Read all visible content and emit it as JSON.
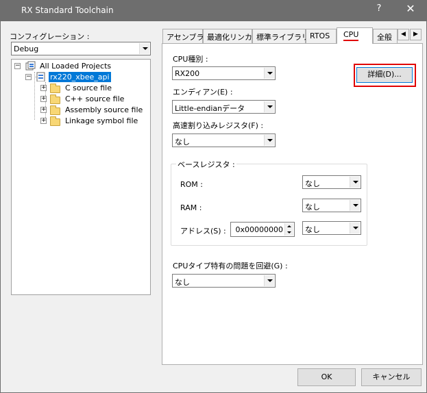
{
  "window": {
    "title": "RX Standard Toolchain",
    "help_label": "?",
    "close_label": "✕"
  },
  "config": {
    "label": "コンフィグレーション :",
    "value": "Debug"
  },
  "tree": {
    "root": {
      "label": "All Loaded Projects",
      "expander": "−"
    },
    "project": {
      "label": "rx220_xbee_api",
      "expander": "−"
    },
    "items": [
      {
        "label": "C source file",
        "expander": "+"
      },
      {
        "label": "C++ source file",
        "expander": "+"
      },
      {
        "label": "Assembly source file",
        "expander": "+"
      },
      {
        "label": "Linkage symbol file",
        "expander": "+"
      }
    ]
  },
  "tabs": [
    {
      "label": "アセンブラ"
    },
    {
      "label": "最適化リンカ"
    },
    {
      "label": "標準ライブラリ"
    },
    {
      "label": "RTOS"
    },
    {
      "label": "CPU"
    },
    {
      "label": "全般"
    }
  ],
  "tab_scroll": {
    "left": "◀",
    "right": "▶"
  },
  "cpu": {
    "cpu_type_label": "CPU種別 :",
    "cpu_type_value": "RX200",
    "detail_button": "詳細(D)...",
    "endian_label": "エンディアン(E) :",
    "endian_value": "Little-endianデータ",
    "fast_int_label": "高速割り込みレジスタ(F) :",
    "fast_int_value": "なし",
    "base_reg_group": "ベースレジスタ :",
    "rom_label": "ROM :",
    "rom_value": "なし",
    "ram_label": "RAM :",
    "ram_value": "なし",
    "address_label": "アドレス(S) :",
    "address_value": "0x00000000",
    "address_reg_value": "なし",
    "cpu_issue_label": "CPUタイプ特有の問題を回避(G) :",
    "cpu_issue_value": "なし"
  },
  "buttons": {
    "ok": "OK",
    "cancel": "キャンセル"
  },
  "colors": {
    "titlebar": "#6e6e6e",
    "selection": "#0078d7",
    "highlight": "#e00000"
  }
}
